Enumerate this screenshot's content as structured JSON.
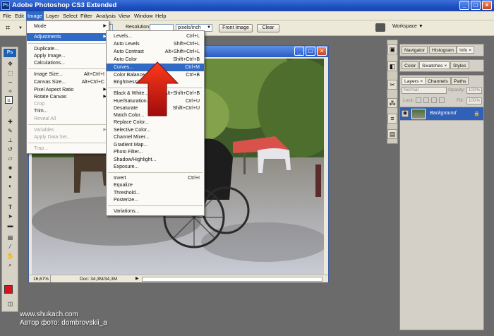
{
  "window": {
    "title": "Adobe Photoshop CS3 Extended",
    "app_icon": "Ps",
    "min": "_",
    "max": "□",
    "close": "×"
  },
  "menubar": [
    "File",
    "Edit",
    "Image",
    "Layer",
    "Select",
    "Filter",
    "Analysis",
    "View",
    "Window",
    "Help"
  ],
  "options": {
    "resolution_label": "Resolution:",
    "resolution_unit": "pixels/inch",
    "front_image": "Front Image",
    "clear": "Clear",
    "workspace": "Workspace ▼"
  },
  "image_menu": [
    {
      "label": "Mode",
      "arrow": true
    },
    {
      "label": "Adjustments",
      "arrow": true,
      "hl": true
    },
    {
      "label": "Duplicate..."
    },
    {
      "label": "Apply Image..."
    },
    {
      "label": "Calculations..."
    },
    {
      "label": "Image Size...",
      "sc": "Alt+Ctrl+I"
    },
    {
      "label": "Canvas Size...",
      "sc": "Alt+Ctrl+C"
    },
    {
      "label": "Pixel Aspect Ratio",
      "arrow": true
    },
    {
      "label": "Rotate Canvas",
      "arrow": true
    },
    {
      "label": "Crop",
      "dis": true
    },
    {
      "label": "Trim..."
    },
    {
      "label": "Reveal All",
      "dis": true
    },
    {
      "label": "Variables",
      "arrow": true,
      "dis": true
    },
    {
      "label": "Apply Data Set...",
      "dis": true
    },
    {
      "label": "Trap...",
      "dis": true
    }
  ],
  "adjust_menu": [
    {
      "label": "Levels...",
      "sc": "Ctrl+L"
    },
    {
      "label": "Auto Levels",
      "sc": "Shift+Ctrl+L"
    },
    {
      "label": "Auto Contrast",
      "sc": "Alt+Shift+Ctrl+L"
    },
    {
      "label": "Auto Color",
      "sc": "Shift+Ctrl+B"
    },
    {
      "label": "Curves...",
      "sc": "Ctrl+M",
      "hl": true
    },
    {
      "label": "Color Balance...",
      "sc": "Ctrl+B"
    },
    {
      "label": "Brightness/Contrast..."
    },
    {
      "label": "Black & White...",
      "sc": "Alt+Shift+Ctrl+B"
    },
    {
      "label": "Hue/Saturation...",
      "sc": "Ctrl+U"
    },
    {
      "label": "Desaturate",
      "sc": "Shift+Ctrl+U"
    },
    {
      "label": "Match Color..."
    },
    {
      "label": "Replace Color..."
    },
    {
      "label": "Selective Color..."
    },
    {
      "label": "Channel Mixer..."
    },
    {
      "label": "Gradient Map..."
    },
    {
      "label": "Photo Filter..."
    },
    {
      "label": "Shadow/Highlight..."
    },
    {
      "label": "Exposure..."
    },
    {
      "label": "Invert",
      "sc": "Ctrl+I"
    },
    {
      "label": "Equalize"
    },
    {
      "label": "Threshold..."
    },
    {
      "label": "Posterize..."
    },
    {
      "label": "Variations..."
    }
  ],
  "status": {
    "zoom": "16,67%",
    "doc": "Doc: 34,3M/34,3M"
  },
  "panels": {
    "nav_tabs": [
      "Navigator",
      "Histogram",
      "Info ×"
    ],
    "color_tabs": [
      "Color",
      "Swatches ×",
      "Styles"
    ],
    "layers_tabs": [
      "Layers ×",
      "Channels",
      "Paths"
    ],
    "blend_mode": "Normal",
    "opacity_label": "Opacity:",
    "opacity": "100%",
    "lock_label": "Lock:",
    "fill_label": "Fill:",
    "fill": "100%",
    "layer_name": "Background"
  },
  "watermark": {
    "line1": "www.shukach.com",
    "line2": "Автор фото: dombrovskii_a"
  },
  "colors": {
    "accent": "#316ac5",
    "titlebar": "#1e4fc0",
    "foreground_swatch": "#e0101a",
    "arrow": "#e0201a"
  }
}
